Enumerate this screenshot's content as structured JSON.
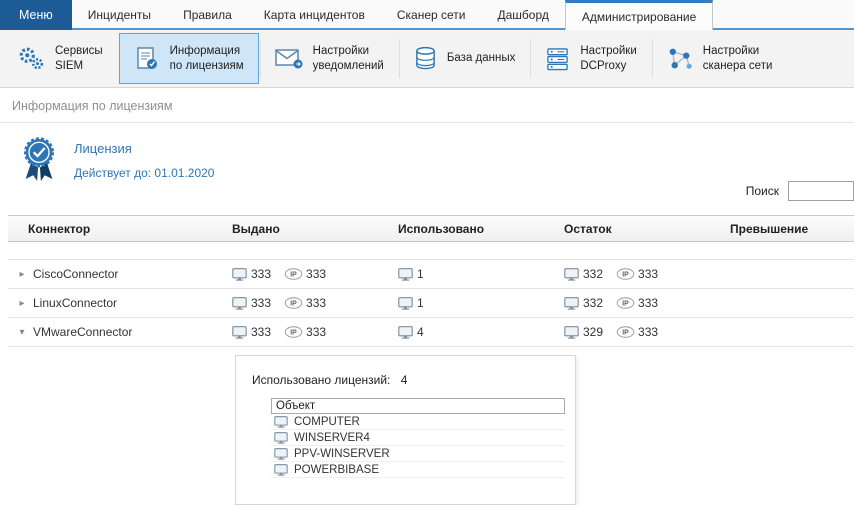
{
  "menu": {
    "label": "Меню"
  },
  "tabs": {
    "items": [
      {
        "label": "Инциденты"
      },
      {
        "label": "Правила"
      },
      {
        "label": "Карта инцидентов"
      },
      {
        "label": "Сканер сети"
      },
      {
        "label": "Дашборд"
      },
      {
        "label": "Администрирование"
      }
    ],
    "active": "Администрирование"
  },
  "toolbar": {
    "items": [
      {
        "line1": "Сервисы",
        "line2": "SIEM"
      },
      {
        "line1": "Информация",
        "line2": "по лицензиям"
      },
      {
        "line1": "Настройки",
        "line2": "уведомлений"
      },
      {
        "line1": "База данных",
        "line2": ""
      },
      {
        "line1": "Настройки",
        "line2": "DCProxy"
      },
      {
        "line1": "Настройки",
        "line2": "сканера сети"
      }
    ],
    "active": "Информация по лицензиям"
  },
  "section": {
    "title": "Информация по лицензиям"
  },
  "license": {
    "title": "Лицензия",
    "valid": "Действует до: 01.01.2020"
  },
  "search": {
    "label": "Поиск",
    "value": ""
  },
  "icons": {
    "ip_label": "IP"
  },
  "table": {
    "headers": [
      "Коннектор",
      "Выдано",
      "Использовано",
      "Остаток",
      "Превышение"
    ],
    "rows": [
      {
        "arrow": "▸",
        "name": "CiscoConnector",
        "issued_pc": "333",
        "issued_ip": "333",
        "used_pc": "1",
        "rest_pc": "332",
        "rest_ip": "333",
        "excess": ""
      },
      {
        "arrow": "▸",
        "name": "LinuxConnector",
        "issued_pc": "333",
        "issued_ip": "333",
        "used_pc": "1",
        "rest_pc": "332",
        "rest_ip": "333",
        "excess": ""
      },
      {
        "arrow": "▾",
        "name": "VMwareConnector",
        "issued_pc": "333",
        "issued_ip": "333",
        "used_pc": "4",
        "rest_pc": "329",
        "rest_ip": "333",
        "excess": ""
      }
    ]
  },
  "detail": {
    "used_label": "Использовано лицензий:",
    "used_count": "4",
    "object_header": "Объект",
    "objects": [
      {
        "name": "COMPUTER"
      },
      {
        "name": "WINSERVER4"
      },
      {
        "name": "PPV-WINSERVER"
      },
      {
        "name": "POWERBIBASE"
      }
    ]
  },
  "colors": {
    "accent": "#2e76b5",
    "menu_bg": "#1d5c97",
    "selected_item_bg": "#cee6f8",
    "tab_line": "#4f96d2"
  }
}
